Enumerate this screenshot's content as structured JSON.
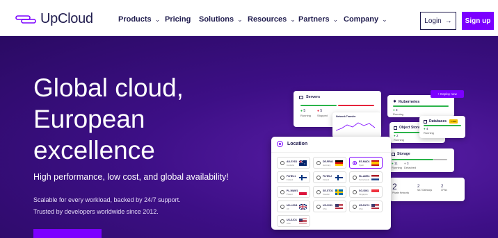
{
  "brand": {
    "name": "UpCloud"
  },
  "nav": {
    "items": [
      {
        "label": "Products",
        "has_menu": true
      },
      {
        "label": "Pricing",
        "has_menu": false
      },
      {
        "label": "Solutions",
        "has_menu": true
      },
      {
        "label": "Resources",
        "has_menu": true
      },
      {
        "label": "Partners",
        "has_menu": true
      },
      {
        "label": "Company",
        "has_menu": true
      }
    ],
    "login": "Login",
    "signup": "Sign up"
  },
  "hero": {
    "title_line1": "Global cloud,",
    "title_line2": "European",
    "title_line3": "excellence",
    "subtitle": "High performance, low cost, and global availability!",
    "line1": "Scalable for every workload, backed by 24/7 support.",
    "line2": "Trusted by developers worldwide since 2012."
  },
  "dashboard": {
    "servers": {
      "title": "Servers",
      "running_count": "5",
      "running_label": "Running",
      "stopped_count": "5",
      "stopped_label": "Stopped"
    },
    "network": {
      "title": "Network Transfer"
    },
    "kubernetes": {
      "title": "Kubernetes",
      "count": "3",
      "label": "Running"
    },
    "deploy_label": "+ Deploy now",
    "databases": {
      "title": "Databases",
      "badge": "1 alert",
      "count": "4",
      "label": "Running"
    },
    "object_storage": {
      "title": "Object Storages",
      "count": "2",
      "label": "Running"
    },
    "storage": {
      "title": "Storage",
      "a_count": "11",
      "a_label": "Running",
      "b_count": "3",
      "b_label": "Detached"
    },
    "counts": [
      {
        "value": "2",
        "label": "Private Networks"
      },
      {
        "value": "2",
        "label": "NAT Gateways"
      },
      {
        "value": "2",
        "label": "CFWs"
      }
    ],
    "location": {
      "title": "Location",
      "items": [
        {
          "code": "AU-SYD1",
          "city": "Australia",
          "flag": "au",
          "selected": false
        },
        {
          "code": "DE-FRA1",
          "city": "Germany",
          "flag": "de",
          "selected": false
        },
        {
          "code": "ES-MAD1",
          "city": "Spain",
          "flag": "es",
          "selected": true
        },
        {
          "code": "FI-HEL1",
          "city": "Finland",
          "flag": "fi",
          "selected": false
        },
        {
          "code": "FI-HEL2",
          "city": "Finland",
          "flag": "fi",
          "selected": false
        },
        {
          "code": "NL-AMS1",
          "city": "Netherlands",
          "flag": "nl",
          "selected": false
        },
        {
          "code": "PL-WAW1",
          "city": "Poland",
          "flag": "pl",
          "selected": false
        },
        {
          "code": "SE-STO1",
          "city": "Sweden",
          "flag": "se",
          "selected": false
        },
        {
          "code": "SG-SIN1",
          "city": "Singapore",
          "flag": "sg",
          "selected": false
        },
        {
          "code": "UK-LON1",
          "city": "UK",
          "flag": "uk",
          "selected": false
        },
        {
          "code": "US-CHI1",
          "city": "USA",
          "flag": "us",
          "selected": false
        },
        {
          "code": "US-NYC1",
          "city": "USA",
          "flag": "us",
          "selected": false
        },
        {
          "code": "US-SJO1",
          "city": "USA",
          "flag": "us",
          "selected": false
        }
      ]
    }
  }
}
